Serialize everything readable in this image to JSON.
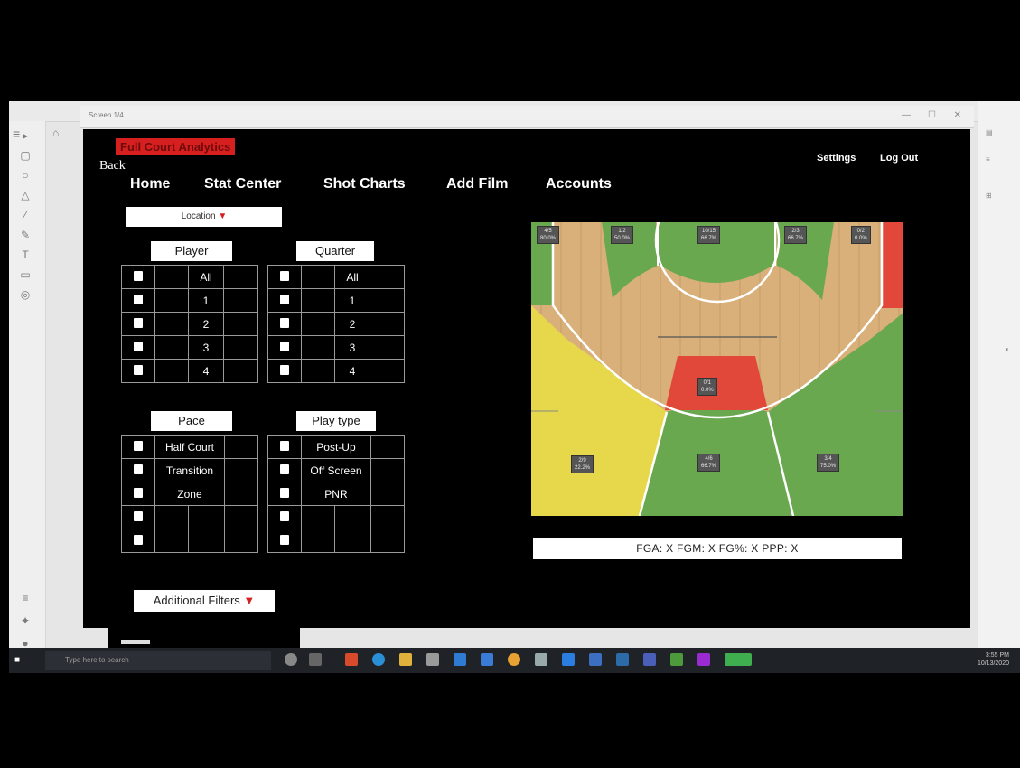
{
  "window": {
    "title": "Screen 1/4"
  },
  "brand": "Full Court Analytics",
  "back": "Back",
  "topright": {
    "settings": "Settings",
    "logout": "Log Out"
  },
  "nav": [
    {
      "label": "Home"
    },
    {
      "label": "Stat Center"
    },
    {
      "label": "Shot Charts"
    },
    {
      "label": "Add Film"
    },
    {
      "label": "Accounts"
    }
  ],
  "location": {
    "label": "Location",
    "arrow": "▼"
  },
  "filters": {
    "player": {
      "header": "Player",
      "rows": [
        "All",
        "1",
        "2",
        "3",
        "4"
      ]
    },
    "quarter": {
      "header": "Quarter",
      "rows": [
        "All",
        "1",
        "2",
        "3",
        "4"
      ]
    },
    "pace": {
      "header": "Pace",
      "rows": [
        "Half Court",
        "Transition",
        "Zone",
        "",
        ""
      ]
    },
    "playtype": {
      "header": "Play type",
      "rows": [
        "Post-Up",
        "Off Screen",
        "PNR",
        "",
        ""
      ]
    }
  },
  "court_zones": [
    {
      "made": "4/5",
      "pct": "80.0%",
      "color": "#6aa84f"
    },
    {
      "made": "1/2",
      "pct": "50.0%",
      "color": "#6aa84f"
    },
    {
      "made": "10/15",
      "pct": "66.7%",
      "color": "#6aa84f"
    },
    {
      "made": "2/3",
      "pct": "66.7%",
      "color": "#6aa84f"
    },
    {
      "made": "0/2",
      "pct": "0.0%",
      "color": "#e2483a"
    },
    {
      "made": "0/1",
      "pct": "0.0%",
      "color": "#e2483a"
    },
    {
      "made": "2/9",
      "pct": "22.2%",
      "color": "#e6d84a"
    },
    {
      "made": "4/6",
      "pct": "66.7%",
      "color": "#6aa84f"
    },
    {
      "made": "3/4",
      "pct": "75.0%",
      "color": "#6aa84f"
    }
  ],
  "stats_line": "FGA: X   FGM: X   FG%: X   PPP: X",
  "additional_filters": {
    "label": "Additional Filters",
    "arrow": "▼"
  },
  "taskbar": {
    "search_placeholder": "Type here to search",
    "time": "3:55 PM",
    "date": "10/13/2020"
  }
}
